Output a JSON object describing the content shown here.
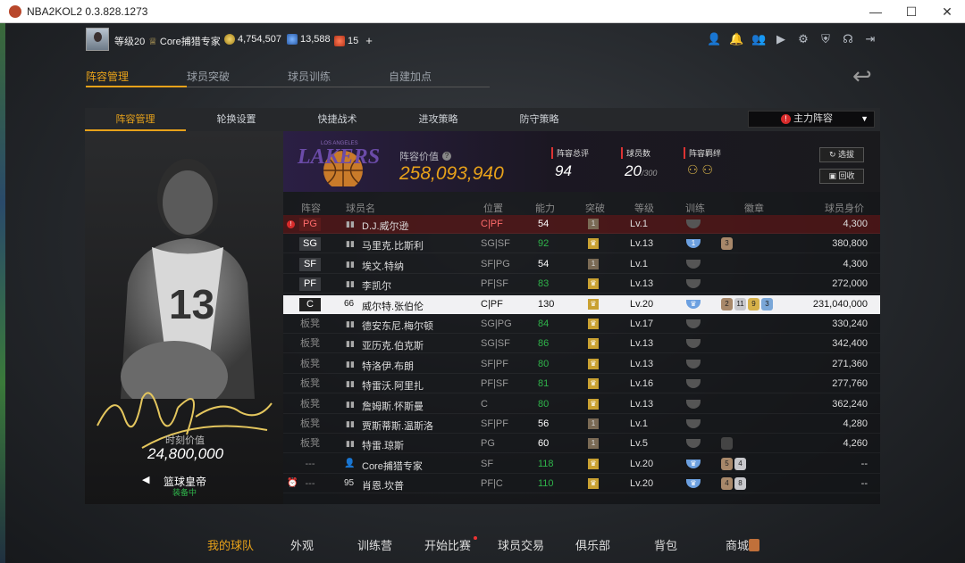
{
  "window": {
    "title": "NBA2KOL2 0.3.828.1273",
    "minimize": "—",
    "maximize": "☐",
    "close": "✕"
  },
  "header": {
    "level": "等级20",
    "title_label": "Core捕猎专家",
    "gold": "4,754,507",
    "points": "13,588",
    "tickets": "15",
    "plus": "+"
  },
  "main_tabs": [
    {
      "label": "阵容管理",
      "active": true
    },
    {
      "label": "球员突破",
      "active": false
    },
    {
      "label": "球员训练",
      "active": false
    },
    {
      "label": "自建加点",
      "active": false
    }
  ],
  "sub_tabs": [
    {
      "label": "阵容管理",
      "active": true
    },
    {
      "label": "轮换设置",
      "active": false
    },
    {
      "label": "快捷战术",
      "active": false
    },
    {
      "label": "进攻策略",
      "active": false
    },
    {
      "label": "防守策略",
      "active": false
    }
  ],
  "lineup_select": {
    "label": "主力阵容",
    "warning": "!"
  },
  "card": {
    "value_label": "时刻价值",
    "value": "24,800,000",
    "name": "篮球皇帝",
    "status": "装备中",
    "jersey": "13"
  },
  "summary": {
    "value_label": "阵容价值",
    "value": "258,093,940",
    "rating_label": "阵容总评",
    "rating": "94",
    "player_count_label": "球员数",
    "player_count": "20",
    "player_max": "/300",
    "chem_label": "阵容羁绊",
    "select_btn": "选拔",
    "recycle_btn": "回收",
    "logo_text": "LAKERS",
    "logo_sub": "LOS ANGELES"
  },
  "table": {
    "headers": [
      "阵容",
      "球员名",
      "位置",
      "能力",
      "突破",
      "等级",
      "训练",
      "徽章",
      "球员身价"
    ],
    "rows": [
      {
        "slot": "PG",
        "slot_type": "warn",
        "prefix": "",
        "name": "D.J.威尔逊",
        "pos": "C|PF",
        "pos_warn": true,
        "ovr": "54",
        "ovr_color": "white",
        "brk": "1",
        "level": "Lv.1",
        "train": "",
        "badges": [],
        "value": "4,300",
        "warn": true
      },
      {
        "slot": "SG",
        "slot_type": "starter",
        "prefix": "",
        "name": "马里克.比斯利",
        "pos": "SG|SF",
        "ovr": "92",
        "ovr_color": "green",
        "brk": "♛",
        "level": "Lv.13",
        "train": "1",
        "badges": [
          {
            "t": "bronze",
            "v": "3"
          }
        ],
        "value": "380,800"
      },
      {
        "slot": "SF",
        "slot_type": "starter",
        "prefix": "",
        "name": "埃文.特纳",
        "pos": "SF|PG",
        "ovr": "54",
        "ovr_color": "white",
        "brk": "1",
        "level": "Lv.1",
        "train": "",
        "badges": [],
        "value": "4,300"
      },
      {
        "slot": "PF",
        "slot_type": "starter",
        "prefix": "",
        "name": "李凯尔",
        "pos": "PF|SF",
        "ovr": "83",
        "ovr_color": "green",
        "brk": "♛",
        "level": "Lv.13",
        "train": "",
        "badges": [],
        "value": "272,000"
      },
      {
        "slot": "C",
        "slot_type": "starter",
        "prefix": "66",
        "name": "威尔特.张伯伦",
        "pos": "C|PF",
        "ovr": "130",
        "ovr_color": "white",
        "brk": "♛",
        "level": "Lv.20",
        "train": "♛",
        "badges": [
          {
            "t": "bronze",
            "v": "2"
          },
          {
            "t": "silver",
            "v": "11"
          },
          {
            "t": "gold",
            "v": "9"
          },
          {
            "t": "hof",
            "v": "3"
          }
        ],
        "value": "231,040,000",
        "highlight": true
      },
      {
        "slot": "板凳",
        "slot_type": "bench",
        "prefix": "",
        "name": "德安东尼.梅尔顿",
        "pos": "SG|PG",
        "ovr": "84",
        "ovr_color": "green",
        "brk": "♛",
        "level": "Lv.17",
        "train": "",
        "badges": [],
        "value": "330,240"
      },
      {
        "slot": "板凳",
        "slot_type": "bench",
        "prefix": "",
        "name": "亚历克.伯克斯",
        "pos": "SG|SF",
        "ovr": "86",
        "ovr_color": "green",
        "brk": "♛",
        "level": "Lv.13",
        "train": "",
        "badges": [],
        "value": "342,400"
      },
      {
        "slot": "板凳",
        "slot_type": "bench",
        "prefix": "",
        "name": "特洛伊.布朗",
        "pos": "SF|PF",
        "ovr": "80",
        "ovr_color": "green",
        "brk": "♛",
        "level": "Lv.13",
        "train": "",
        "badges": [],
        "value": "271,360"
      },
      {
        "slot": "板凳",
        "slot_type": "bench",
        "prefix": "",
        "name": "特雷沃.阿里扎",
        "pos": "PF|SF",
        "ovr": "81",
        "ovr_color": "green",
        "brk": "♛",
        "level": "Lv.16",
        "train": "",
        "badges": [],
        "value": "277,760"
      },
      {
        "slot": "板凳",
        "slot_type": "bench",
        "prefix": "",
        "name": "詹姆斯.怀斯曼",
        "pos": "C",
        "ovr": "80",
        "ovr_color": "green",
        "brk": "♛",
        "level": "Lv.13",
        "train": "",
        "badges": [],
        "value": "362,240"
      },
      {
        "slot": "板凳",
        "slot_type": "bench",
        "prefix": "",
        "name": "贾斯蒂斯.温斯洛",
        "pos": "SF|PF",
        "ovr": "56",
        "ovr_color": "white",
        "brk": "1",
        "level": "Lv.1",
        "train": "",
        "badges": [],
        "value": "4,280"
      },
      {
        "slot": "板凳",
        "slot_type": "bench",
        "prefix": "",
        "name": "特雷.琼斯",
        "pos": "PG",
        "ovr": "60",
        "ovr_color": "white",
        "brk": "1",
        "level": "Lv.5",
        "train": "",
        "badges": [
          {
            "t": "empty",
            "v": ""
          }
        ],
        "value": "4,260"
      },
      {
        "slot": "---",
        "slot_type": "none",
        "prefix": "👤",
        "name": "Core捕猎专家",
        "pos": "SF",
        "ovr": "118",
        "ovr_color": "green",
        "brk": "♛",
        "level": "Lv.20",
        "train": "♛",
        "badges": [
          {
            "t": "bronze",
            "v": "5"
          },
          {
            "t": "silver",
            "v": "4"
          }
        ],
        "value": "--"
      },
      {
        "slot": "---",
        "slot_type": "none",
        "prefix": "95",
        "name": "肖恩.坎普",
        "pos": "PF|C",
        "ovr": "110",
        "ovr_color": "green",
        "brk": "♛",
        "level": "Lv.20",
        "train": "♛",
        "badges": [
          {
            "t": "bronze",
            "v": "4"
          },
          {
            "t": "silver",
            "v": "8"
          }
        ],
        "value": "--"
      }
    ]
  },
  "bottom_nav": [
    {
      "label": "我的球队",
      "active": true
    },
    {
      "label": "外观",
      "active": false
    },
    {
      "label": "训练营",
      "active": false
    },
    {
      "label": "开始比赛",
      "active": false,
      "dot": true
    },
    {
      "label": "球员交易",
      "active": false
    },
    {
      "label": "俱乐部",
      "active": false
    },
    {
      "label": "背包",
      "active": false
    },
    {
      "label": "商城",
      "active": false
    }
  ],
  "colors": {
    "accent": "#e8a21a",
    "green": "#2fb34a",
    "warn": "#d82b2b"
  }
}
